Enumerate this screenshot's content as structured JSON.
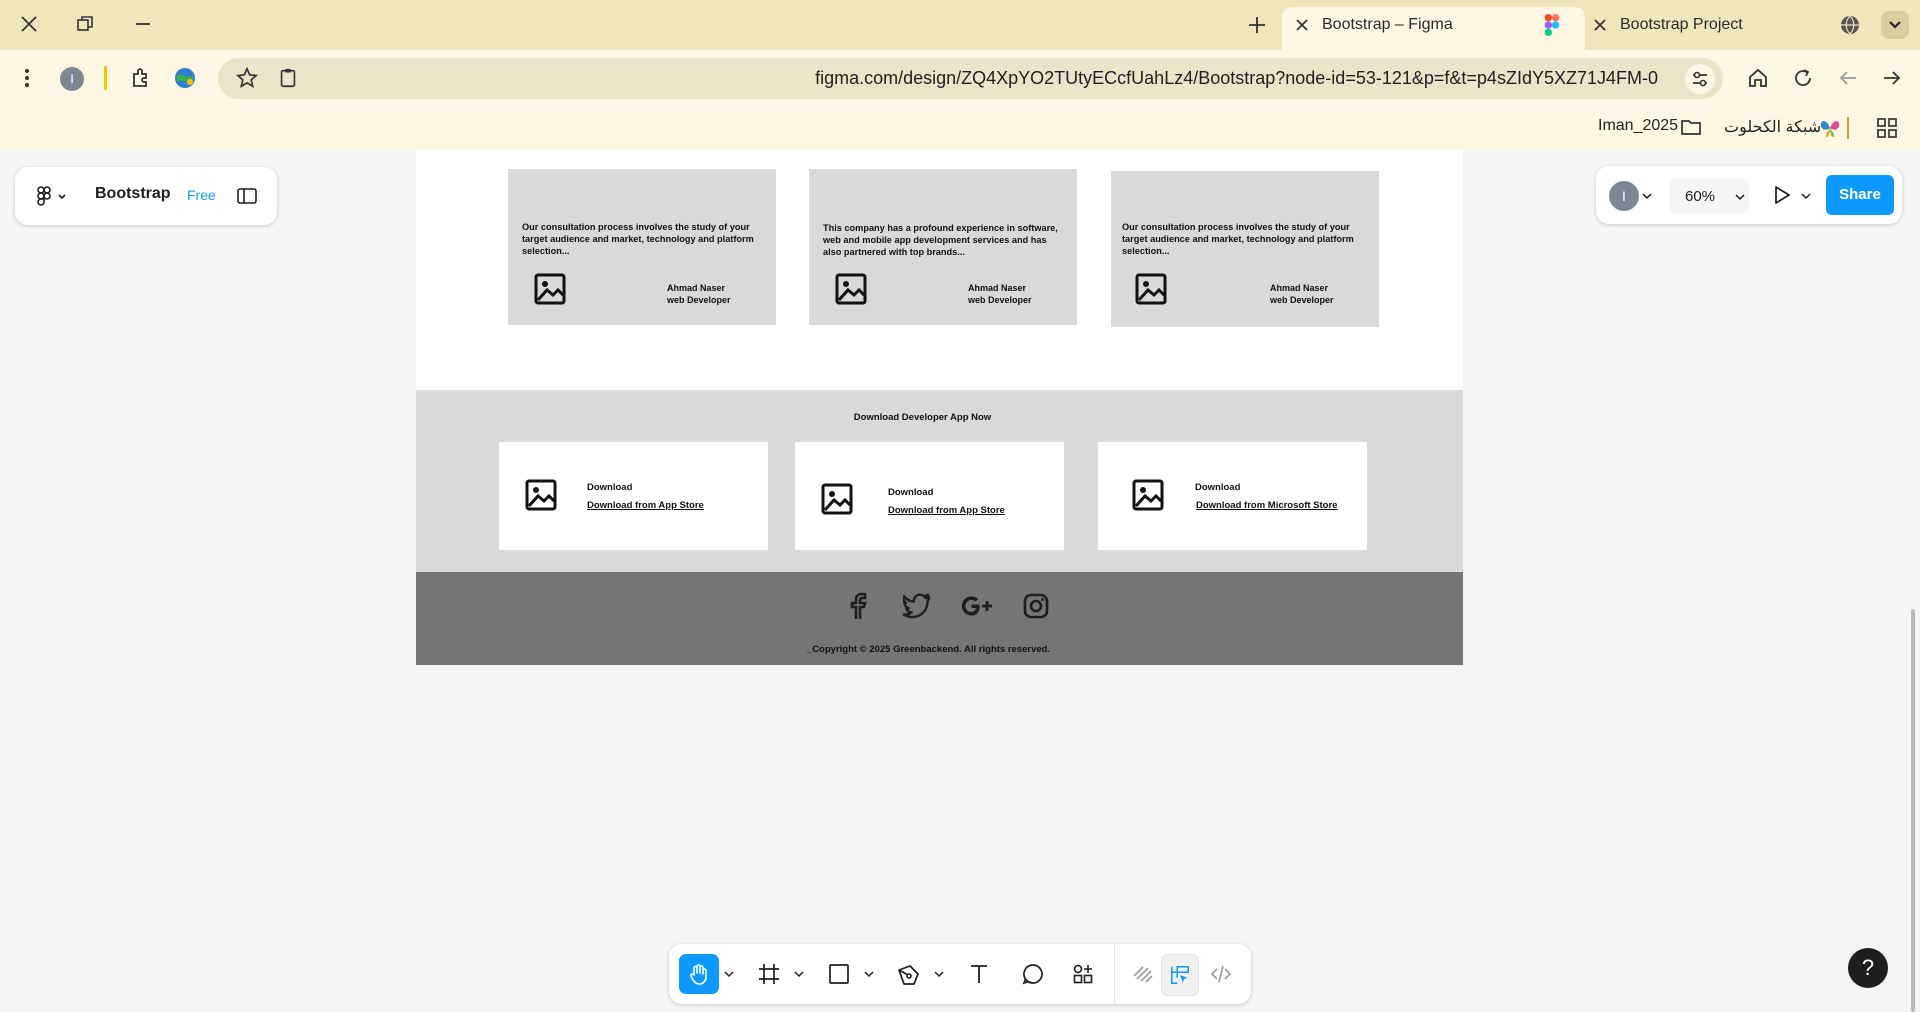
{
  "browser": {
    "tabs": [
      {
        "title": "Bootstrap – Figma",
        "active": true
      },
      {
        "title": "Bootstrap Project",
        "active": false
      }
    ],
    "url": "figma.com/design/ZQ4XpYO2TUtyECcfUahLz4/Bootstrap?node-id=53-121&p=f&t=p4sZIdY5XZ71J4FM-0",
    "profile_initial": "I",
    "bookmarks": [
      {
        "label": "Iman_2025",
        "icon": "folder-icon"
      },
      {
        "label": "شبكة الكحلوت",
        "icon": "butterfly-icon"
      }
    ],
    "colors": {
      "tabstrip": "#efe6bb",
      "toolbar": "#fdf6e3"
    }
  },
  "figma": {
    "file_name": "Bootstrap",
    "plan": "Free",
    "user_initial": "I",
    "zoom": "60%",
    "share_label": "Share",
    "accent": "#0d99ff",
    "help": "?"
  },
  "design": {
    "testimonials": [
      {
        "text": "Our consultation process involves the study of your target audience and market, technology and platform selection...",
        "name": "Ahmad Naser",
        "role": "web Developer"
      },
      {
        "text": "This company has a profound experience in software, web and mobile app development services and has also partnered with top brands...",
        "name": "Ahmad Naser",
        "role": "web Developer"
      },
      {
        "text": "Our consultation process involves the study of your target audience and market, technology and platform selection...",
        "name": "Ahmad Naser",
        "role": "web Developer"
      }
    ],
    "download_title": "Download Developer App Now",
    "downloads": [
      {
        "label": "Download",
        "link": "Download from App Store"
      },
      {
        "label": "Download",
        "link": "Download from App Store"
      },
      {
        "label": "Download",
        "link": "Download from Microsoft Store"
      }
    ],
    "social_icons": [
      "facebook-icon",
      "twitter-icon",
      "google-plus-icon",
      "instagram-icon"
    ],
    "copyright": "_Copyright © 2025 Greenbackend. All rights reserved."
  }
}
